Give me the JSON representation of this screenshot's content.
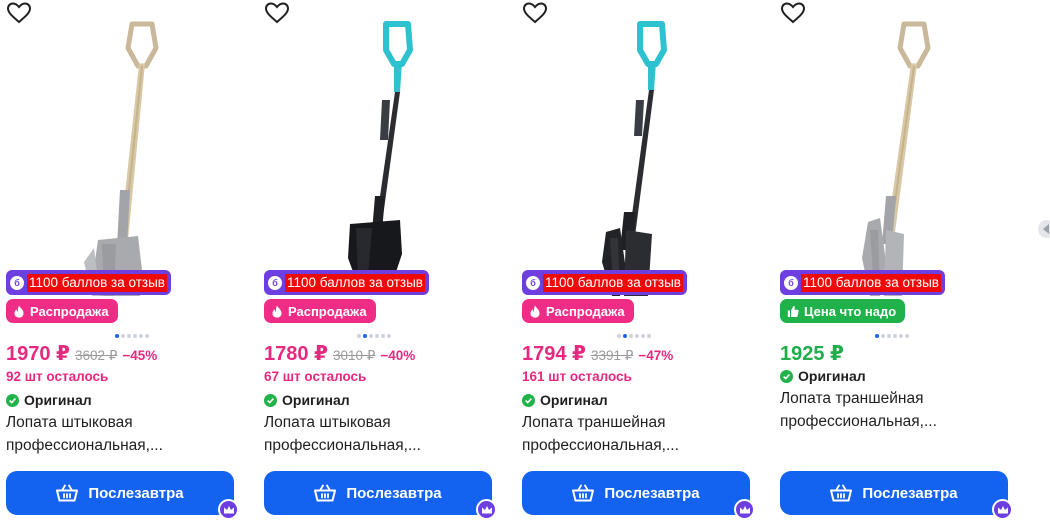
{
  "products": [
    {
      "favorite_icon": "heart-icon",
      "reviews_badge": {
        "icon": "б",
        "label": "1100 баллов за отзыв"
      },
      "tag": {
        "label": "Распродажа",
        "kind": "sale",
        "icon": "fire-icon",
        "color": "#ef2c86"
      },
      "images_total": 6,
      "image_active": 0,
      "price": "1970 ₽",
      "old_price": "3602 ₽",
      "discount": "−45%",
      "stock": "92 шт осталось",
      "original_label": "Оригинал",
      "title_line1": "Лопата штыковая",
      "title_line2": "профессиональная,...",
      "button_label": "Послезавтра",
      "shovel": {
        "handle_color": "#c9b89a",
        "shaft_color": "#d8c8a6",
        "blade_color": "#a9aaae"
      }
    },
    {
      "favorite_icon": "heart-icon",
      "reviews_badge": {
        "icon": "б",
        "label": "1100 баллов за отзыв"
      },
      "tag": {
        "label": "Распродажа",
        "kind": "sale",
        "icon": "fire-icon",
        "color": "#ef2c86"
      },
      "images_total": 6,
      "image_active": 1,
      "price": "1780 ₽",
      "old_price": "3010 ₽",
      "discount": "−40%",
      "stock": "67 шт осталось",
      "original_label": "Оригинал",
      "title_line1": "Лопата штыковая",
      "title_line2": "профессиональная,...",
      "button_label": "Послезавтра",
      "shovel": {
        "handle_color": "#2ec1cf",
        "shaft_color": "#2b2d31",
        "blade_color": "#17181b"
      }
    },
    {
      "favorite_icon": "heart-icon",
      "reviews_badge": {
        "icon": "б",
        "label": "1100 баллов за отзыв"
      },
      "tag": {
        "label": "Распродажа",
        "kind": "sale",
        "icon": "fire-icon",
        "color": "#ef2c86"
      },
      "images_total": 6,
      "image_active": 1,
      "price": "1794 ₽",
      "old_price": "3391 ₽",
      "discount": "−47%",
      "stock": "161 шт осталось",
      "original_label": "Оригинал",
      "title_line1": "Лопата траншейная",
      "title_line2": "профессиональная,...",
      "button_label": "Послезавтра",
      "shovel": {
        "handle_color": "#2ec1cf",
        "shaft_color": "#2b2d31",
        "blade_color": "#222327"
      }
    },
    {
      "favorite_icon": "heart-icon",
      "reviews_badge": {
        "icon": "б",
        "label": "1100 баллов за отзыв"
      },
      "tag": {
        "label": "Цена что надо",
        "kind": "good",
        "icon": "thumbs-up-icon",
        "color": "#20b24a"
      },
      "images_total": 6,
      "image_active": 0,
      "price": "1925 ₽",
      "old_price": "",
      "discount": "",
      "stock": "",
      "original_label": "Оригинал",
      "title_line1": "Лопата траншейная",
      "title_line2": "профессиональная,...",
      "button_label": "Послезавтра",
      "shovel": {
        "handle_color": "#c9b89a",
        "shaft_color": "#d8c8a6",
        "blade_color": "#a9aaae"
      }
    }
  ],
  "colors": {
    "accent_blue": "#1462f0",
    "reviews_purple": "#6d3fe0",
    "highlight_red": "#ee0a0a",
    "price_pink": "#e6297e",
    "price_green": "#1fae49"
  }
}
